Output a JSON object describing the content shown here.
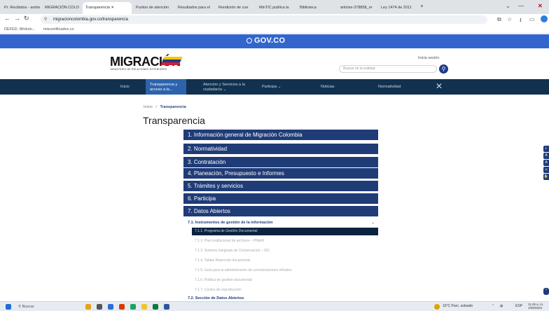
{
  "browser": {
    "tabs": [
      {
        "label": "Pr. Recibidos - andre"
      },
      {
        "label": "MIGRACIÓN COLO"
      },
      {
        "label": "Transparencia"
      },
      {
        "label": "Puntos de atención"
      },
      {
        "label": "Resultados para el"
      },
      {
        "label": "Rendición de cue"
      },
      {
        "label": "MinTIC publica la"
      },
      {
        "label": "Biblioteca"
      },
      {
        "label": "articles-378858_re"
      },
      {
        "label": "Ley 1474 de 2011"
      }
    ],
    "url": "migracioncolombia.gov.co/transparencia",
    "bookmarks": [
      "DEFED, Módulo...",
      "miscertificados.co"
    ]
  },
  "gov": {
    "label": "GOV.CO"
  },
  "header": {
    "logo": "MIGRACIÓN",
    "logo_sub": "MINISTERIO DE RELACIONES EXTERIORES",
    "login": "Inicia sesión",
    "search_placeholder": "Buscar en la entidad",
    "logo_colors": [
      "#f7c600",
      "#1f3c88",
      "#d5202e"
    ]
  },
  "nav": {
    "items": [
      {
        "label": "Inicio"
      },
      {
        "label": "Transparencia y acceso a la..."
      },
      {
        "label": "Atención y Servicios a la ciudadanía ⌄"
      },
      {
        "label": "Participa ⌄"
      },
      {
        "label": "Noticias"
      },
      {
        "label": "Normatividad"
      }
    ]
  },
  "breadcrumb": {
    "home": "Inicio",
    "sep": "/",
    "current": "Transparencia"
  },
  "page": {
    "title": "Transparencia"
  },
  "accordion": {
    "sections": [
      {
        "label": "1. Información general de Migración Colombia"
      },
      {
        "label": "2. Normatividad"
      },
      {
        "label": "3. Contratación"
      },
      {
        "label": "4. Planeación, Presupuesto e Informes"
      },
      {
        "label": "5. Trámites y servicios"
      },
      {
        "label": "6. Participa"
      },
      {
        "label": "7. Datos Abiertos"
      }
    ],
    "subheading": "7.1. Instrumentos de gestión de la información",
    "subitems": [
      {
        "label": "7.1.1. Programa de Gestión Documental"
      },
      {
        "label": "7.1.2. Plan institucional de archivos – PINAR"
      },
      {
        "label": "7.1.3. Sistema Integrado de Conservación – SIC"
      },
      {
        "label": "7.1.4. Tablas Retención documental"
      },
      {
        "label": "7.1.5. Guía para la administración de comunicaciones oficiales"
      },
      {
        "label": "7.1.6. Política de gestión documental"
      },
      {
        "label": "7.1.7. Costos de reproducción"
      }
    ],
    "subheading2": "7.2. Sección de Datos Abiertos"
  },
  "taskbar": {
    "search": "Buscar",
    "weather": "16°C Parc. soleado",
    "lang": "ESP",
    "time": "11:49 a. m.",
    "date": "1/08/2023"
  }
}
